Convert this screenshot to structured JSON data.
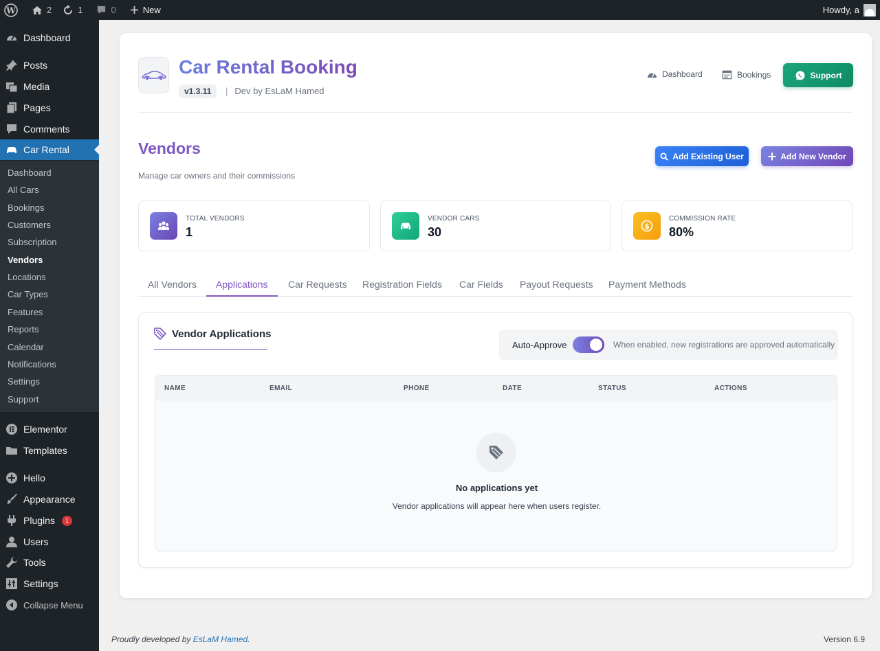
{
  "colors": {
    "accent": "#7e57c2",
    "wp_blue": "#2271b1",
    "support_green": "#1aa57a"
  },
  "adminbar": {
    "home_count": "2",
    "updates_count": "1",
    "comments_count": "0",
    "new_label": "New",
    "howdy": "Howdy, a"
  },
  "sidebar": {
    "dashboard": "Dashboard",
    "posts": "Posts",
    "media": "Media",
    "pages": "Pages",
    "comments": "Comments",
    "car_rental": "Car Rental",
    "submenu": [
      "Dashboard",
      "All Cars",
      "Bookings",
      "Customers",
      "Subscription",
      "Vendors",
      "Locations",
      "Car Types",
      "Features",
      "Reports",
      "Calendar",
      "Notifications",
      "Settings",
      "Support"
    ],
    "elementor": "Elementor",
    "templates": "Templates",
    "hello": "Hello",
    "appearance": "Appearance",
    "plugins": "Plugins",
    "plugins_badge": "1",
    "users": "Users",
    "tools": "Tools",
    "settings": "Settings",
    "collapse": "Collapse Menu"
  },
  "header": {
    "title": "Car Rental Booking",
    "version": "v1.3.11",
    "separator": "|",
    "dev": "Dev by EsLaM Hamed",
    "links": {
      "dashboard": "Dashboard",
      "bookings": "Bookings",
      "support": "Support"
    }
  },
  "page": {
    "title": "Vendors",
    "subtitle": "Manage car owners and their commissions",
    "add_existing": "Add Existing User",
    "add_new": "Add New Vendor"
  },
  "stats": [
    {
      "label": "TOTAL VENDORS",
      "value": "1"
    },
    {
      "label": "VENDOR CARS",
      "value": "30"
    },
    {
      "label": "COMMISSION RATE",
      "value": "80%"
    }
  ],
  "tabs": [
    "All Vendors",
    "Applications",
    "Car Requests",
    "Registration Fields",
    "Car Fields",
    "Payout Requests",
    "Payment Methods"
  ],
  "active_tab": "Applications",
  "panel": {
    "title": "Vendor Applications",
    "auto_approve_label": "Auto-Approve",
    "auto_approve_on": true,
    "auto_approve_hint": "When enabled, new registrations are approved automatically",
    "columns": [
      "NAME",
      "EMAIL",
      "PHONE",
      "DATE",
      "STATUS",
      "ACTIONS"
    ],
    "empty_title": "No applications yet",
    "empty_desc": "Vendor applications will appear here when users register."
  },
  "footer": {
    "prefix": "Proudly developed by ",
    "author": "EsLaM Hamed",
    "suffix": ".",
    "version": "Version 6.9"
  }
}
